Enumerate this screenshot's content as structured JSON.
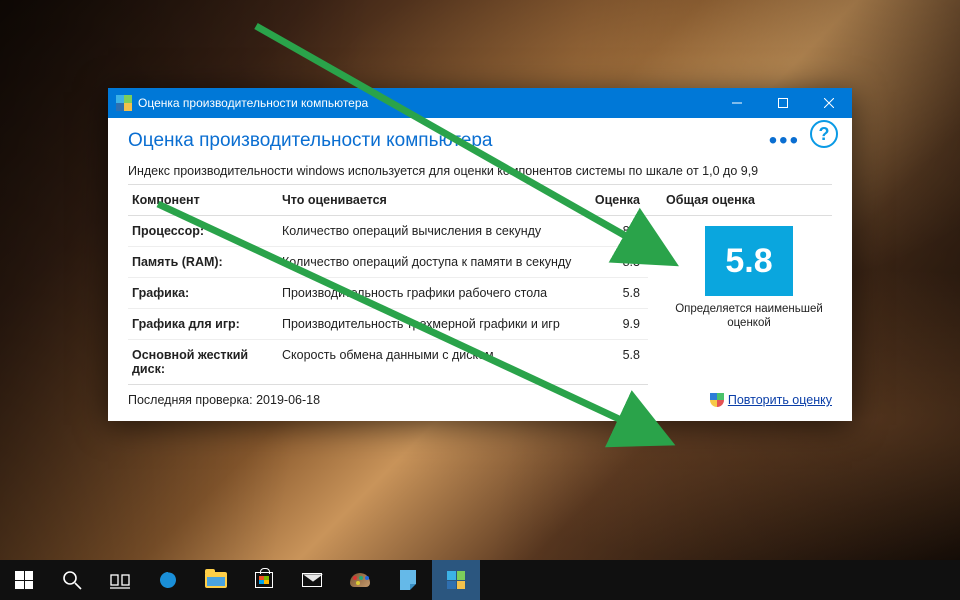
{
  "colors": {
    "accent": "#0078d7",
    "score_box": "#0aa6de",
    "link": "#0a3ea8"
  },
  "window": {
    "title": "Оценка производительности компьютера",
    "page_title": "Оценка производительности компьютера",
    "subtitle": "Индекс производительности windows используется для оценки компонентов системы по шкале от 1,0 до 9,9"
  },
  "table": {
    "headers": {
      "component": "Компонент",
      "what": "Что оценивается",
      "score": "Оценка",
      "overall": "Общая оценка"
    },
    "rows": [
      {
        "component": "Процессор:",
        "what": "Количество операций вычисления в секунду",
        "score": "8.3"
      },
      {
        "component": "Память (RAM):",
        "what": "Количество операций доступа к памяти в секунду",
        "score": "8.3"
      },
      {
        "component": "Графика:",
        "what": "Производительность графики рабочего стола",
        "score": "5.8"
      },
      {
        "component": "Графика для игр:",
        "what": "Производительность трехмерной графики и игр",
        "score": "9.9"
      },
      {
        "component": "Основной жесткий диск:",
        "what": "Скорость обмена данными с диском",
        "score": "5.8"
      }
    ]
  },
  "overall": {
    "value": "5.8",
    "caption": "Определяется наименьшей оценкой"
  },
  "footer": {
    "last_check_label": "Последняя проверка:",
    "last_check_value": "2019-06-18",
    "rerun_label": "Повторить оценку"
  },
  "icons": {
    "help": "?",
    "more": "•••"
  }
}
